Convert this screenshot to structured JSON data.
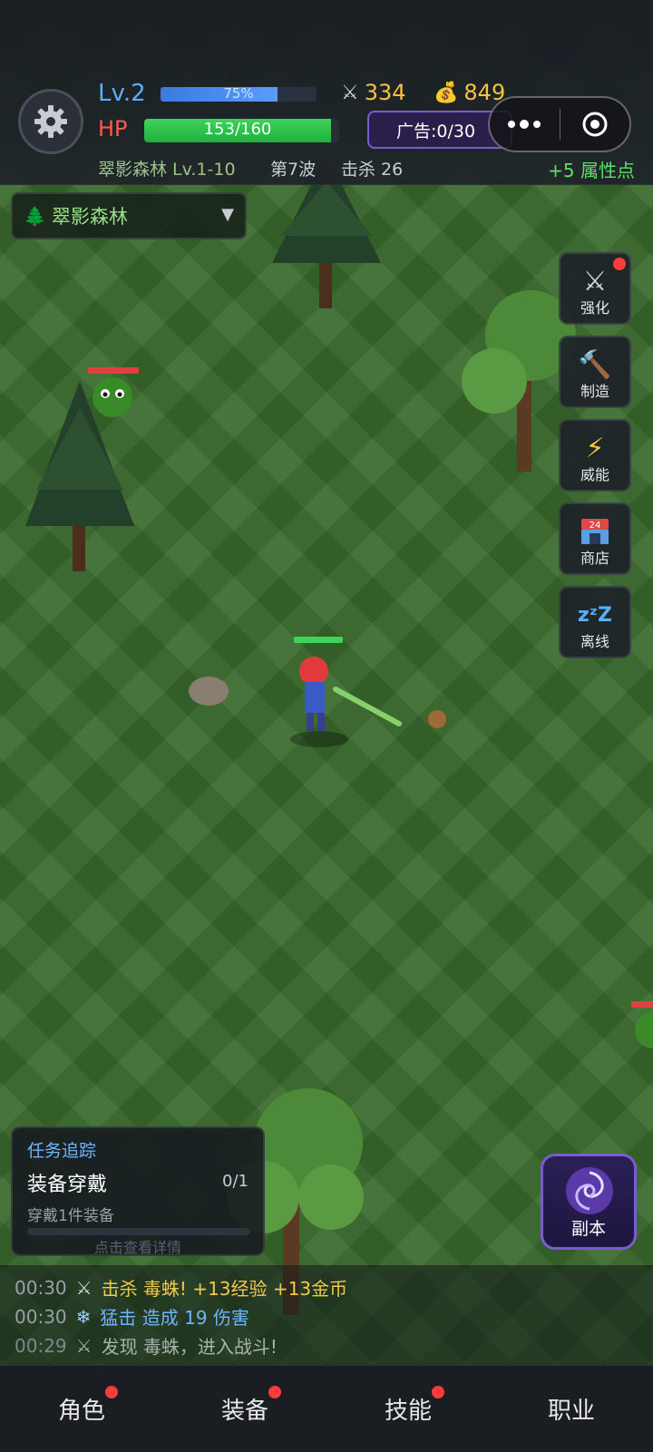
{
  "hud": {
    "level": "Lv.2",
    "exp_text": "75%",
    "exp_percent": 75,
    "hp_label": "HP",
    "hp_text": "153/160",
    "hp_percent": 95.6,
    "attack": "334",
    "gold": "849",
    "ad_text": "广告:0/30",
    "zone_info": "翠影森林 Lv.1-10",
    "wave": "第7波",
    "kills": "击杀 26",
    "attr_points": "+5 属性点"
  },
  "zone_select": {
    "label": "翠影森林",
    "icon": "tree-icon"
  },
  "side_menu": [
    {
      "label": "强化",
      "icon": "swords-icon",
      "badge": true
    },
    {
      "label": "制造",
      "icon": "hammer-icon",
      "badge": false
    },
    {
      "label": "威能",
      "icon": "lightning-icon",
      "badge": false
    },
    {
      "label": "商店",
      "icon": "store-icon",
      "badge": false
    },
    {
      "label": "离线",
      "icon": "sleep-icon",
      "badge": false
    }
  ],
  "store_icon_text": "24",
  "quest": {
    "header": "任务追踪",
    "title": "装备穿戴",
    "count": "0/1",
    "desc": "穿戴1件装备",
    "hint": "点击查看详情"
  },
  "dungeon": {
    "label": "副本"
  },
  "log": [
    {
      "time": "00:30",
      "icon": "swords-icon",
      "text": "击杀 毒蛛! +13经验 +13金币",
      "color": "#f2c94c"
    },
    {
      "time": "00:30",
      "icon": "snowflake-icon",
      "text": "猛击 造成 19 伤害",
      "color": "#6fb4ff"
    },
    {
      "time": "00:29",
      "icon": "swords-icon",
      "text": "发现 毒蛛，进入战斗!",
      "color": "#d6d8dc"
    }
  ],
  "tabs": [
    {
      "label": "角色",
      "badge": true
    },
    {
      "label": "装备",
      "badge": true
    },
    {
      "label": "技能",
      "badge": true
    },
    {
      "label": "职业",
      "badge": false
    }
  ]
}
